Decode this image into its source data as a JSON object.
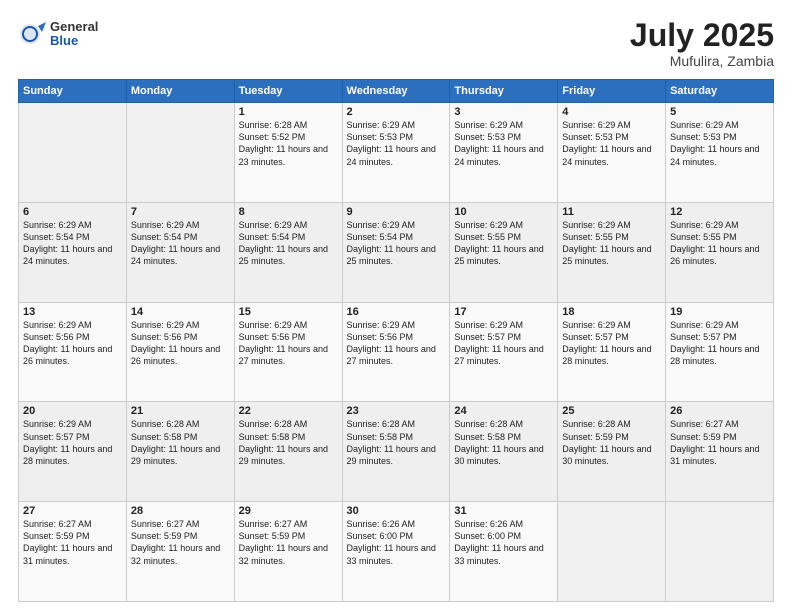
{
  "header": {
    "logo_general": "General",
    "logo_blue": "Blue",
    "title": "July 2025",
    "location": "Mufulira, Zambia"
  },
  "days_of_week": [
    "Sunday",
    "Monday",
    "Tuesday",
    "Wednesday",
    "Thursday",
    "Friday",
    "Saturday"
  ],
  "weeks": [
    [
      {
        "day": "",
        "info": ""
      },
      {
        "day": "",
        "info": ""
      },
      {
        "day": "1",
        "info": "Sunrise: 6:28 AM\nSunset: 5:52 PM\nDaylight: 11 hours and 23 minutes."
      },
      {
        "day": "2",
        "info": "Sunrise: 6:29 AM\nSunset: 5:53 PM\nDaylight: 11 hours and 24 minutes."
      },
      {
        "day": "3",
        "info": "Sunrise: 6:29 AM\nSunset: 5:53 PM\nDaylight: 11 hours and 24 minutes."
      },
      {
        "day": "4",
        "info": "Sunrise: 6:29 AM\nSunset: 5:53 PM\nDaylight: 11 hours and 24 minutes."
      },
      {
        "day": "5",
        "info": "Sunrise: 6:29 AM\nSunset: 5:53 PM\nDaylight: 11 hours and 24 minutes."
      }
    ],
    [
      {
        "day": "6",
        "info": "Sunrise: 6:29 AM\nSunset: 5:54 PM\nDaylight: 11 hours and 24 minutes."
      },
      {
        "day": "7",
        "info": "Sunrise: 6:29 AM\nSunset: 5:54 PM\nDaylight: 11 hours and 24 minutes."
      },
      {
        "day": "8",
        "info": "Sunrise: 6:29 AM\nSunset: 5:54 PM\nDaylight: 11 hours and 25 minutes."
      },
      {
        "day": "9",
        "info": "Sunrise: 6:29 AM\nSunset: 5:54 PM\nDaylight: 11 hours and 25 minutes."
      },
      {
        "day": "10",
        "info": "Sunrise: 6:29 AM\nSunset: 5:55 PM\nDaylight: 11 hours and 25 minutes."
      },
      {
        "day": "11",
        "info": "Sunrise: 6:29 AM\nSunset: 5:55 PM\nDaylight: 11 hours and 25 minutes."
      },
      {
        "day": "12",
        "info": "Sunrise: 6:29 AM\nSunset: 5:55 PM\nDaylight: 11 hours and 26 minutes."
      }
    ],
    [
      {
        "day": "13",
        "info": "Sunrise: 6:29 AM\nSunset: 5:56 PM\nDaylight: 11 hours and 26 minutes."
      },
      {
        "day": "14",
        "info": "Sunrise: 6:29 AM\nSunset: 5:56 PM\nDaylight: 11 hours and 26 minutes."
      },
      {
        "day": "15",
        "info": "Sunrise: 6:29 AM\nSunset: 5:56 PM\nDaylight: 11 hours and 27 minutes."
      },
      {
        "day": "16",
        "info": "Sunrise: 6:29 AM\nSunset: 5:56 PM\nDaylight: 11 hours and 27 minutes."
      },
      {
        "day": "17",
        "info": "Sunrise: 6:29 AM\nSunset: 5:57 PM\nDaylight: 11 hours and 27 minutes."
      },
      {
        "day": "18",
        "info": "Sunrise: 6:29 AM\nSunset: 5:57 PM\nDaylight: 11 hours and 28 minutes."
      },
      {
        "day": "19",
        "info": "Sunrise: 6:29 AM\nSunset: 5:57 PM\nDaylight: 11 hours and 28 minutes."
      }
    ],
    [
      {
        "day": "20",
        "info": "Sunrise: 6:29 AM\nSunset: 5:57 PM\nDaylight: 11 hours and 28 minutes."
      },
      {
        "day": "21",
        "info": "Sunrise: 6:28 AM\nSunset: 5:58 PM\nDaylight: 11 hours and 29 minutes."
      },
      {
        "day": "22",
        "info": "Sunrise: 6:28 AM\nSunset: 5:58 PM\nDaylight: 11 hours and 29 minutes."
      },
      {
        "day": "23",
        "info": "Sunrise: 6:28 AM\nSunset: 5:58 PM\nDaylight: 11 hours and 29 minutes."
      },
      {
        "day": "24",
        "info": "Sunrise: 6:28 AM\nSunset: 5:58 PM\nDaylight: 11 hours and 30 minutes."
      },
      {
        "day": "25",
        "info": "Sunrise: 6:28 AM\nSunset: 5:59 PM\nDaylight: 11 hours and 30 minutes."
      },
      {
        "day": "26",
        "info": "Sunrise: 6:27 AM\nSunset: 5:59 PM\nDaylight: 11 hours and 31 minutes."
      }
    ],
    [
      {
        "day": "27",
        "info": "Sunrise: 6:27 AM\nSunset: 5:59 PM\nDaylight: 11 hours and 31 minutes."
      },
      {
        "day": "28",
        "info": "Sunrise: 6:27 AM\nSunset: 5:59 PM\nDaylight: 11 hours and 32 minutes."
      },
      {
        "day": "29",
        "info": "Sunrise: 6:27 AM\nSunset: 5:59 PM\nDaylight: 11 hours and 32 minutes."
      },
      {
        "day": "30",
        "info": "Sunrise: 6:26 AM\nSunset: 6:00 PM\nDaylight: 11 hours and 33 minutes."
      },
      {
        "day": "31",
        "info": "Sunrise: 6:26 AM\nSunset: 6:00 PM\nDaylight: 11 hours and 33 minutes."
      },
      {
        "day": "",
        "info": ""
      },
      {
        "day": "",
        "info": ""
      }
    ]
  ]
}
